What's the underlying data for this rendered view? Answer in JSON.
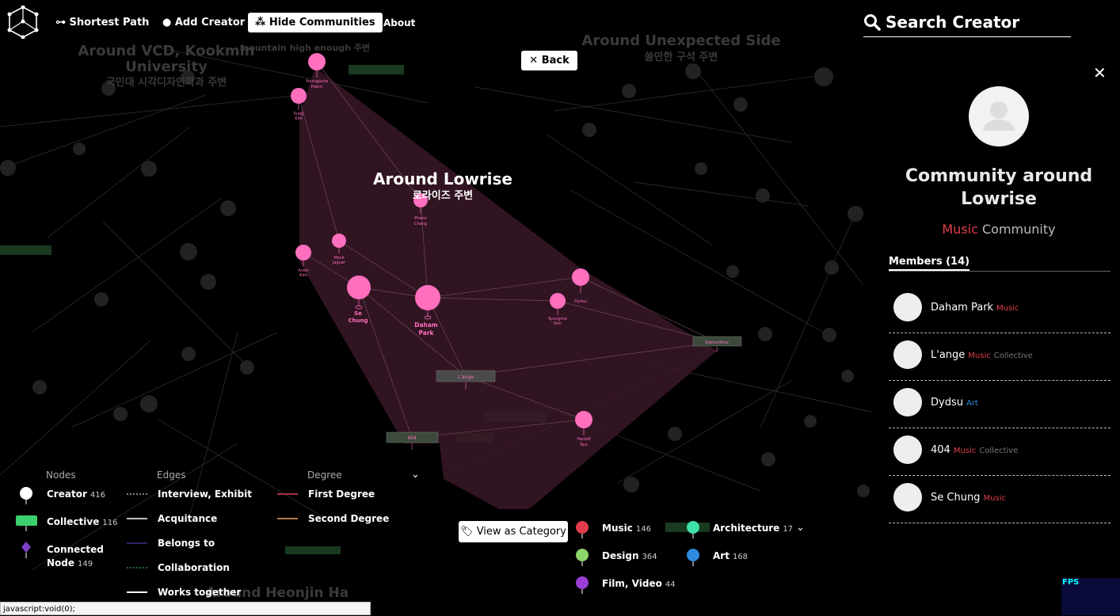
{
  "nav": {
    "shortest_path": "Shortest Path",
    "add_creator": "Add Creator",
    "hide_communities": "Hide Communities",
    "about": "About"
  },
  "back_label": "Back",
  "search": {
    "placeholder": "Search Creator"
  },
  "graph": {
    "community_title": "Around Lowrise",
    "community_title_kr": "로라이즈 주변",
    "bg_labels": [
      "Around VCD, Kookmin",
      "University",
      "국민대 시각디자인학과 주변",
      "Around Unexpected Side",
      "쓸만한 구석 주변",
      "mountain high enough 주변",
      "Around Heonjin Ha"
    ],
    "nodes": [
      {
        "label": [
          "Youngjune",
          "Hahn"
        ]
      },
      {
        "label": [
          "Sung",
          "Kim"
        ]
      },
      {
        "label": [
          "Phano",
          "Chang"
        ]
      },
      {
        "label": [
          "Mock",
          "Jaguar"
        ]
      },
      {
        "label": [
          "Aram",
          "Kim"
        ]
      },
      {
        "label": [
          "Se",
          "Chung"
        ]
      },
      {
        "label": [
          "Daham",
          "Park"
        ]
      },
      {
        "label": [
          "Dydsu"
        ]
      },
      {
        "label": [
          "Kyungmo",
          "Kim"
        ]
      },
      {
        "label": [
          "Hanbill",
          "Ryu"
        ]
      }
    ],
    "collectives": [
      "L'ange",
      "404",
      "SilenceTone"
    ]
  },
  "panel": {
    "title": "Community around Lowrise",
    "category": "Music",
    "category_color": "#e03c4c",
    "community_word": "Community",
    "members_heading": "Members (14)",
    "members": [
      {
        "name": "Daham Park",
        "category": "Music",
        "category_color": "#e03c4c",
        "type": ""
      },
      {
        "name": "L'ange",
        "category": "Music",
        "category_color": "#e03c4c",
        "type": "Collective"
      },
      {
        "name": "Dydsu",
        "category": "Art",
        "category_color": "#2e8bdd",
        "type": ""
      },
      {
        "name": "404",
        "category": "Music",
        "category_color": "#e03c4c",
        "type": "Collective"
      },
      {
        "name": "Se Chung",
        "category": "Music",
        "category_color": "#e03c4c",
        "type": ""
      }
    ]
  },
  "legend": {
    "nodes_heading": "Nodes",
    "edges_heading": "Edges",
    "degree_heading": "Degree",
    "nodes": [
      {
        "label": "Creator",
        "count": "416"
      },
      {
        "label": "Collective",
        "count": "116"
      },
      {
        "label": "Connected",
        "label2": "Node",
        "count": "149"
      }
    ],
    "edges": [
      "Interview, Exhibit",
      "Acquitance",
      "Belongs to",
      "Collaboration",
      "Works together"
    ],
    "degree": [
      "First Degree",
      "Second Degree"
    ],
    "view_as_category": "View as Category",
    "categories": [
      {
        "label": "Music",
        "count": "146",
        "color": "#e03c4c"
      },
      {
        "label": "Design",
        "count": "364",
        "color": "#8dd46a"
      },
      {
        "label": "Film, Video",
        "count": "44",
        "color": "#9b3fd4"
      },
      {
        "label": "Architecture",
        "count": "17",
        "color": "#3fe0a8"
      },
      {
        "label": "Art",
        "count": "168",
        "color": "#2e8bdd"
      }
    ]
  },
  "status_bar": "javascript:void(0);",
  "fps_label": "FPS",
  "colors": {
    "node_pink": "#ff6fbd",
    "hull": "#3a1828"
  }
}
